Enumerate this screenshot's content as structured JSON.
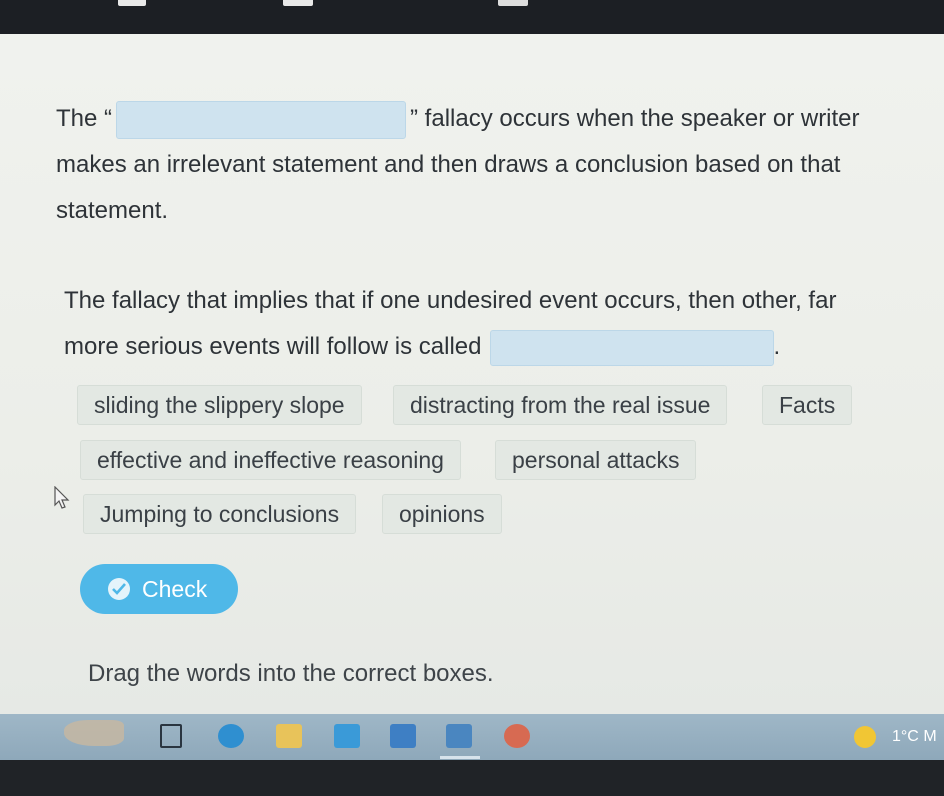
{
  "question1": {
    "prefix": "The “",
    "suffix": "” fallacy occurs when the speaker or writer makes an irrelevant statement and then draws a conclusion based on that statement."
  },
  "question2": {
    "text": "The fallacy that implies that if one undesired event occurs, then other, far more serious events will follow is called",
    "end": "."
  },
  "word_bank": [
    "sliding the slippery slope",
    "distracting from the real issue",
    "Facts",
    "effective and ineffective reasoning",
    "personal attacks",
    "Jumping to conclusions",
    "opinions"
  ],
  "check_button": {
    "label": "Check",
    "icon": "check-circle-icon"
  },
  "instructions": "Drag the words into the correct boxes.",
  "taskbar": {
    "icons": [
      "task-view-icon",
      "edge-icon",
      "file-explorer-icon",
      "mail-icon",
      "store-icon",
      "teams-icon",
      "chrome-icon"
    ],
    "temperature": "1°C",
    "weather_overflow": "M"
  },
  "colors": {
    "accent": "#4fb8e8",
    "drop_box": "#cfe3ef",
    "chip": "#e3e8e3",
    "text": "#2e3338"
  }
}
